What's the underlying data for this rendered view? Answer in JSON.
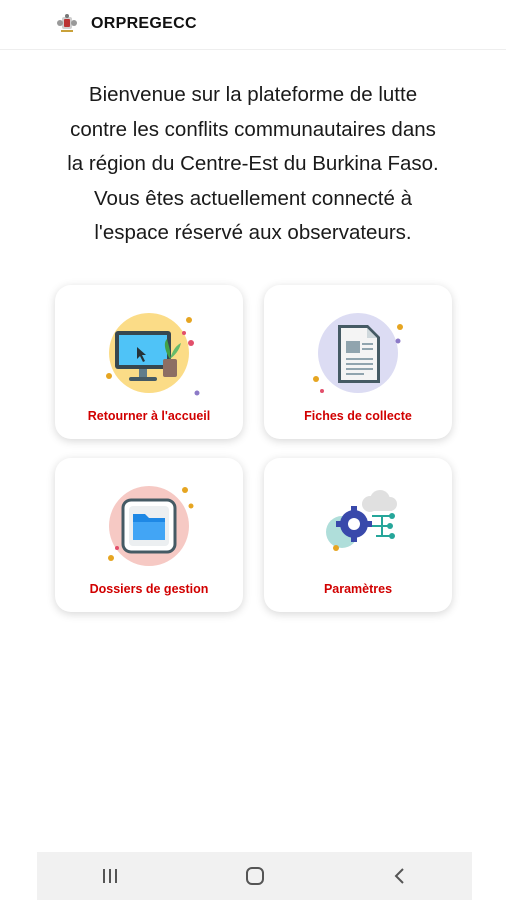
{
  "app": {
    "title": "ORPREGECC"
  },
  "welcome": {
    "lines": [
      "Bienvenue sur la plateforme de lutte",
      "contre les conflits communautaires dans",
      "la région du Centre-Est du Burkina Faso.",
      "Vous êtes actuellement connecté à",
      "l'espace réservé aux observateurs."
    ]
  },
  "menu": [
    {
      "label": "Retourner à l'accueil",
      "icon": "computer-icon"
    },
    {
      "label": "Fiches de collecte",
      "icon": "document-icon"
    },
    {
      "label": "Dossiers de gestion",
      "icon": "folder-icon"
    },
    {
      "label": "Paramètres",
      "icon": "settings-gears-icon"
    }
  ],
  "colors": {
    "label_red": "#d10000",
    "background": "#ffffff",
    "navbar": "#f1f1f1"
  },
  "navbar": {
    "buttons": [
      "recent-apps-icon",
      "home-icon",
      "back-icon"
    ]
  }
}
